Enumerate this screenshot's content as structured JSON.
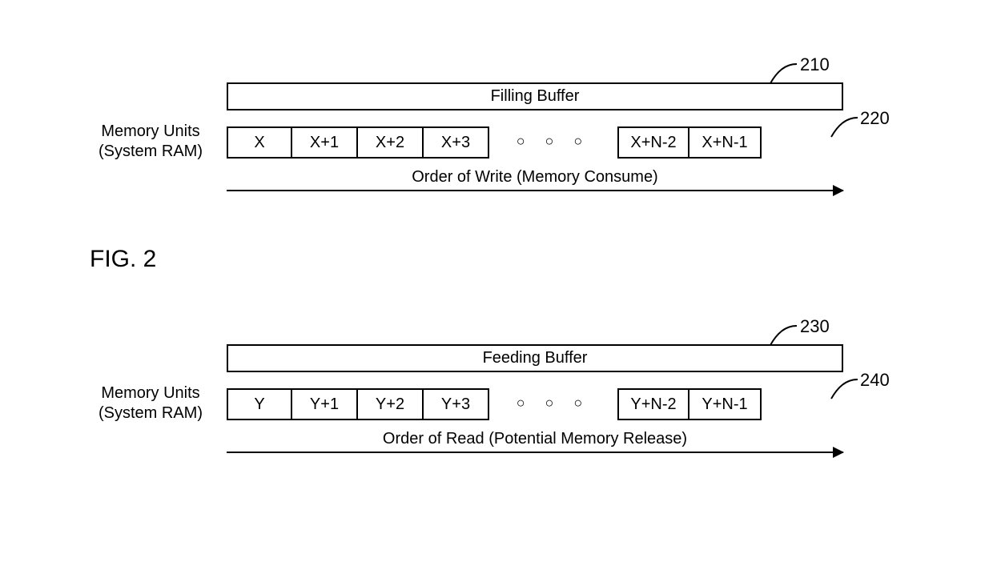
{
  "figure_label": "FIG. 2",
  "left_label_line1": "Memory Units",
  "left_label_line2": "(System RAM)",
  "groups": [
    {
      "ref_buffer": "210",
      "ref_units": "220",
      "buffer_label": "Filling Buffer",
      "cells_left": [
        "X",
        "X+1",
        "X+2",
        "X+3"
      ],
      "cells_right": [
        "X+N-2",
        "X+N-1"
      ],
      "arrow_label": "Order of Write (Memory Consume)"
    },
    {
      "ref_buffer": "230",
      "ref_units": "240",
      "buffer_label": "Feeding Buffer",
      "cells_left": [
        "Y",
        "Y+1",
        "Y+2",
        "Y+3"
      ],
      "cells_right": [
        "Y+N-2",
        "Y+N-1"
      ],
      "arrow_label": "Order of Read (Potential Memory Release)"
    }
  ],
  "ellipsis_glyph": "○ ○ ○"
}
